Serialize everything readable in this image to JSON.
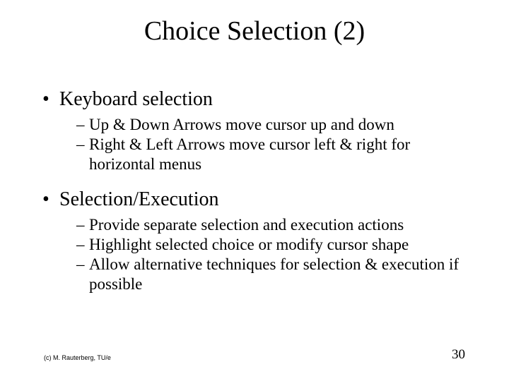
{
  "title": "Choice Selection (2)",
  "bullets": [
    {
      "text": "Keyboard selection",
      "subs": [
        "Up & Down Arrows move cursor up and down",
        "Right & Left Arrows move cursor left & right for horizontal menus"
      ]
    },
    {
      "text": "Selection/Execution",
      "subs": [
        "Provide separate selection and execution actions",
        "Highlight selected choice or modify cursor shape",
        "Allow alternative techniques for selection & execution if possible"
      ]
    }
  ],
  "footer": {
    "left": "(c) M. Rauterberg, TU/e",
    "right": "30"
  }
}
